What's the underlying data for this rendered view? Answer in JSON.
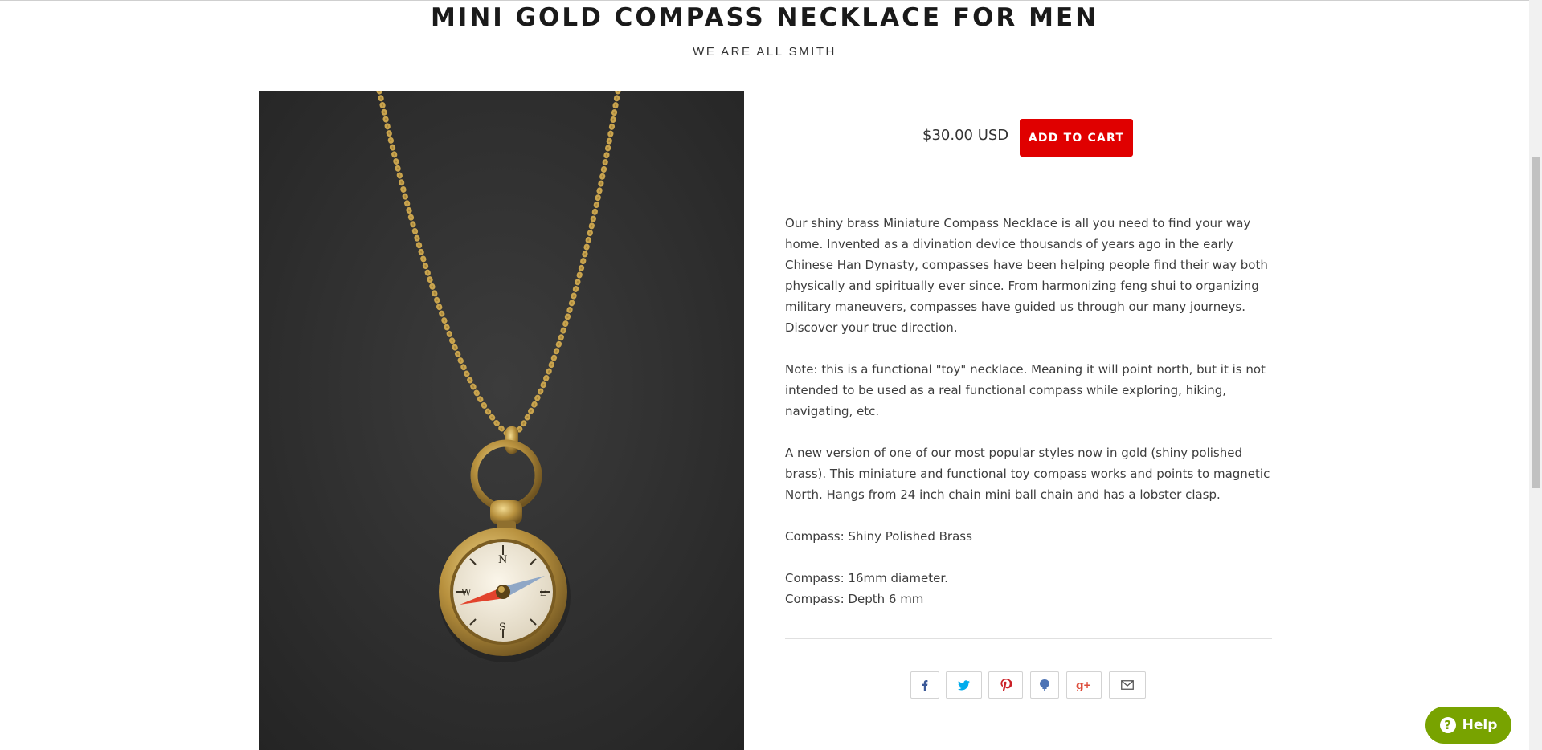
{
  "product": {
    "title": "MINI GOLD COMPASS NECKLACE FOR MEN",
    "vendor": "WE ARE ALL SMITH",
    "price": "$30.00 USD",
    "add_to_cart_label": "ADD TO CART"
  },
  "description": {
    "paragraphs": [
      "Our shiny brass Miniature Compass Necklace is all you need to find your way home. Invented as a divination device thousands of years ago in the early Chinese Han Dynasty, compasses have been helping people find their way both physically and spiritually ever since. From harmonizing feng shui to organizing military maneuvers, compasses have guided us through our many journeys. Discover your true direction.",
      "Note: this is a functional \"toy\" necklace. Meaning it will point north, but it is not intended to be used as a real functional compass while exploring, hiking, navigating, etc.",
      "A new version of one of our most popular styles now in gold (shiny polished brass). This miniature and functional toy compass works and points to magnetic North. Hangs from 24 inch chain mini ball chain and has a lobster clasp.",
      "Compass: Shiny Polished Brass"
    ],
    "specs": [
      "Compass: 16mm diameter.",
      "Compass: Depth 6 mm"
    ]
  },
  "share_buttons": [
    {
      "icon": "facebook-icon"
    },
    {
      "icon": "twitter-icon"
    },
    {
      "icon": "pinterest-icon"
    },
    {
      "icon": "fancy-icon"
    },
    {
      "icon": "google-plus-icon"
    },
    {
      "icon": "email-icon"
    }
  ],
  "help_widget": {
    "label": "Help"
  },
  "colors": {
    "accent": "#e00000",
    "help": "#78a300",
    "text": "#333333"
  }
}
